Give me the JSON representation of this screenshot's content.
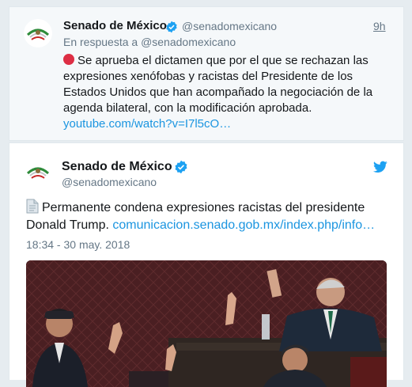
{
  "reply_tweet": {
    "name": "Senado de México",
    "handle": "@senadomexicano",
    "time": "9h",
    "reply_prefix": "En respuesta a",
    "reply_mention": "@senadomexicano",
    "text": "Se aprueba el dictamen que por el que se rechazan las expresiones xenófobas y racistas del Presidente de los Estados Unidos que han acompañado la negociación de la agenda bilateral, con la modificación aprobada.",
    "link": "youtube.com/watch?v=I7l5cO…"
  },
  "main_tweet": {
    "name": "Senado de México",
    "handle": "@senadomexicano",
    "text": "Permanente condena expresiones racistas del presidente Donald Trump.",
    "link": "comunicacion.senado.gob.mx/index.php/info…",
    "timestamp": "18:34 - 30 may. 2018"
  },
  "colors": {
    "link": "#1b95e0",
    "verified": "#1da1f2",
    "muted": "#657786",
    "red_dot": "#dd2e44"
  },
  "icons": {
    "verified": "verified-badge-icon",
    "bird": "twitter-bird-icon",
    "document": "page-facing-up-icon",
    "red_circle": "red-circle-icon"
  }
}
